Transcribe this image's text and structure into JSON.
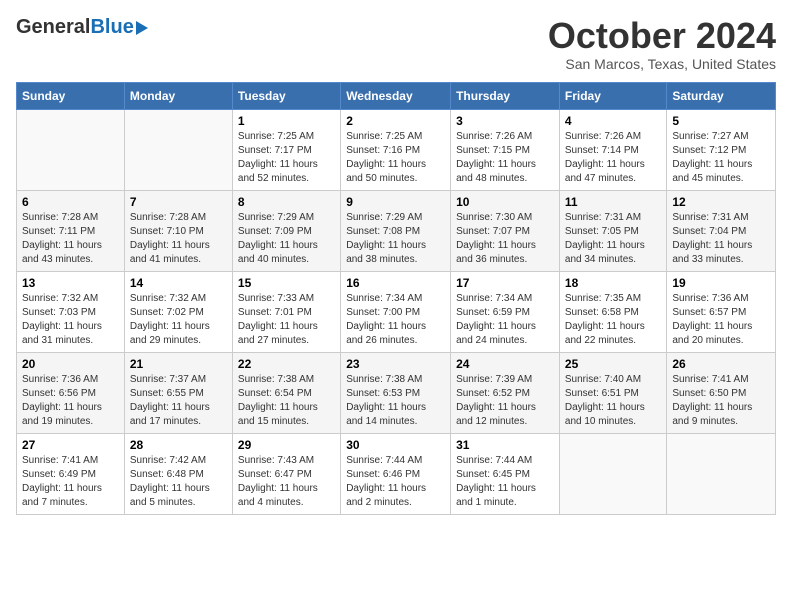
{
  "header": {
    "logo_general": "General",
    "logo_blue": "Blue",
    "month_title": "October 2024",
    "location": "San Marcos, Texas, United States"
  },
  "days_of_week": [
    "Sunday",
    "Monday",
    "Tuesday",
    "Wednesday",
    "Thursday",
    "Friday",
    "Saturday"
  ],
  "weeks": [
    [
      {
        "day": "",
        "sunrise": "",
        "sunset": "",
        "daylight": ""
      },
      {
        "day": "",
        "sunrise": "",
        "sunset": "",
        "daylight": ""
      },
      {
        "day": "1",
        "sunrise": "Sunrise: 7:25 AM",
        "sunset": "Sunset: 7:17 PM",
        "daylight": "Daylight: 11 hours and 52 minutes."
      },
      {
        "day": "2",
        "sunrise": "Sunrise: 7:25 AM",
        "sunset": "Sunset: 7:16 PM",
        "daylight": "Daylight: 11 hours and 50 minutes."
      },
      {
        "day": "3",
        "sunrise": "Sunrise: 7:26 AM",
        "sunset": "Sunset: 7:15 PM",
        "daylight": "Daylight: 11 hours and 48 minutes."
      },
      {
        "day": "4",
        "sunrise": "Sunrise: 7:26 AM",
        "sunset": "Sunset: 7:14 PM",
        "daylight": "Daylight: 11 hours and 47 minutes."
      },
      {
        "day": "5",
        "sunrise": "Sunrise: 7:27 AM",
        "sunset": "Sunset: 7:12 PM",
        "daylight": "Daylight: 11 hours and 45 minutes."
      }
    ],
    [
      {
        "day": "6",
        "sunrise": "Sunrise: 7:28 AM",
        "sunset": "Sunset: 7:11 PM",
        "daylight": "Daylight: 11 hours and 43 minutes."
      },
      {
        "day": "7",
        "sunrise": "Sunrise: 7:28 AM",
        "sunset": "Sunset: 7:10 PM",
        "daylight": "Daylight: 11 hours and 41 minutes."
      },
      {
        "day": "8",
        "sunrise": "Sunrise: 7:29 AM",
        "sunset": "Sunset: 7:09 PM",
        "daylight": "Daylight: 11 hours and 40 minutes."
      },
      {
        "day": "9",
        "sunrise": "Sunrise: 7:29 AM",
        "sunset": "Sunset: 7:08 PM",
        "daylight": "Daylight: 11 hours and 38 minutes."
      },
      {
        "day": "10",
        "sunrise": "Sunrise: 7:30 AM",
        "sunset": "Sunset: 7:07 PM",
        "daylight": "Daylight: 11 hours and 36 minutes."
      },
      {
        "day": "11",
        "sunrise": "Sunrise: 7:31 AM",
        "sunset": "Sunset: 7:05 PM",
        "daylight": "Daylight: 11 hours and 34 minutes."
      },
      {
        "day": "12",
        "sunrise": "Sunrise: 7:31 AM",
        "sunset": "Sunset: 7:04 PM",
        "daylight": "Daylight: 11 hours and 33 minutes."
      }
    ],
    [
      {
        "day": "13",
        "sunrise": "Sunrise: 7:32 AM",
        "sunset": "Sunset: 7:03 PM",
        "daylight": "Daylight: 11 hours and 31 minutes."
      },
      {
        "day": "14",
        "sunrise": "Sunrise: 7:32 AM",
        "sunset": "Sunset: 7:02 PM",
        "daylight": "Daylight: 11 hours and 29 minutes."
      },
      {
        "day": "15",
        "sunrise": "Sunrise: 7:33 AM",
        "sunset": "Sunset: 7:01 PM",
        "daylight": "Daylight: 11 hours and 27 minutes."
      },
      {
        "day": "16",
        "sunrise": "Sunrise: 7:34 AM",
        "sunset": "Sunset: 7:00 PM",
        "daylight": "Daylight: 11 hours and 26 minutes."
      },
      {
        "day": "17",
        "sunrise": "Sunrise: 7:34 AM",
        "sunset": "Sunset: 6:59 PM",
        "daylight": "Daylight: 11 hours and 24 minutes."
      },
      {
        "day": "18",
        "sunrise": "Sunrise: 7:35 AM",
        "sunset": "Sunset: 6:58 PM",
        "daylight": "Daylight: 11 hours and 22 minutes."
      },
      {
        "day": "19",
        "sunrise": "Sunrise: 7:36 AM",
        "sunset": "Sunset: 6:57 PM",
        "daylight": "Daylight: 11 hours and 20 minutes."
      }
    ],
    [
      {
        "day": "20",
        "sunrise": "Sunrise: 7:36 AM",
        "sunset": "Sunset: 6:56 PM",
        "daylight": "Daylight: 11 hours and 19 minutes."
      },
      {
        "day": "21",
        "sunrise": "Sunrise: 7:37 AM",
        "sunset": "Sunset: 6:55 PM",
        "daylight": "Daylight: 11 hours and 17 minutes."
      },
      {
        "day": "22",
        "sunrise": "Sunrise: 7:38 AM",
        "sunset": "Sunset: 6:54 PM",
        "daylight": "Daylight: 11 hours and 15 minutes."
      },
      {
        "day": "23",
        "sunrise": "Sunrise: 7:38 AM",
        "sunset": "Sunset: 6:53 PM",
        "daylight": "Daylight: 11 hours and 14 minutes."
      },
      {
        "day": "24",
        "sunrise": "Sunrise: 7:39 AM",
        "sunset": "Sunset: 6:52 PM",
        "daylight": "Daylight: 11 hours and 12 minutes."
      },
      {
        "day": "25",
        "sunrise": "Sunrise: 7:40 AM",
        "sunset": "Sunset: 6:51 PM",
        "daylight": "Daylight: 11 hours and 10 minutes."
      },
      {
        "day": "26",
        "sunrise": "Sunrise: 7:41 AM",
        "sunset": "Sunset: 6:50 PM",
        "daylight": "Daylight: 11 hours and 9 minutes."
      }
    ],
    [
      {
        "day": "27",
        "sunrise": "Sunrise: 7:41 AM",
        "sunset": "Sunset: 6:49 PM",
        "daylight": "Daylight: 11 hours and 7 minutes."
      },
      {
        "day": "28",
        "sunrise": "Sunrise: 7:42 AM",
        "sunset": "Sunset: 6:48 PM",
        "daylight": "Daylight: 11 hours and 5 minutes."
      },
      {
        "day": "29",
        "sunrise": "Sunrise: 7:43 AM",
        "sunset": "Sunset: 6:47 PM",
        "daylight": "Daylight: 11 hours and 4 minutes."
      },
      {
        "day": "30",
        "sunrise": "Sunrise: 7:44 AM",
        "sunset": "Sunset: 6:46 PM",
        "daylight": "Daylight: 11 hours and 2 minutes."
      },
      {
        "day": "31",
        "sunrise": "Sunrise: 7:44 AM",
        "sunset": "Sunset: 6:45 PM",
        "daylight": "Daylight: 11 hours and 1 minute."
      },
      {
        "day": "",
        "sunrise": "",
        "sunset": "",
        "daylight": ""
      },
      {
        "day": "",
        "sunrise": "",
        "sunset": "",
        "daylight": ""
      }
    ]
  ]
}
